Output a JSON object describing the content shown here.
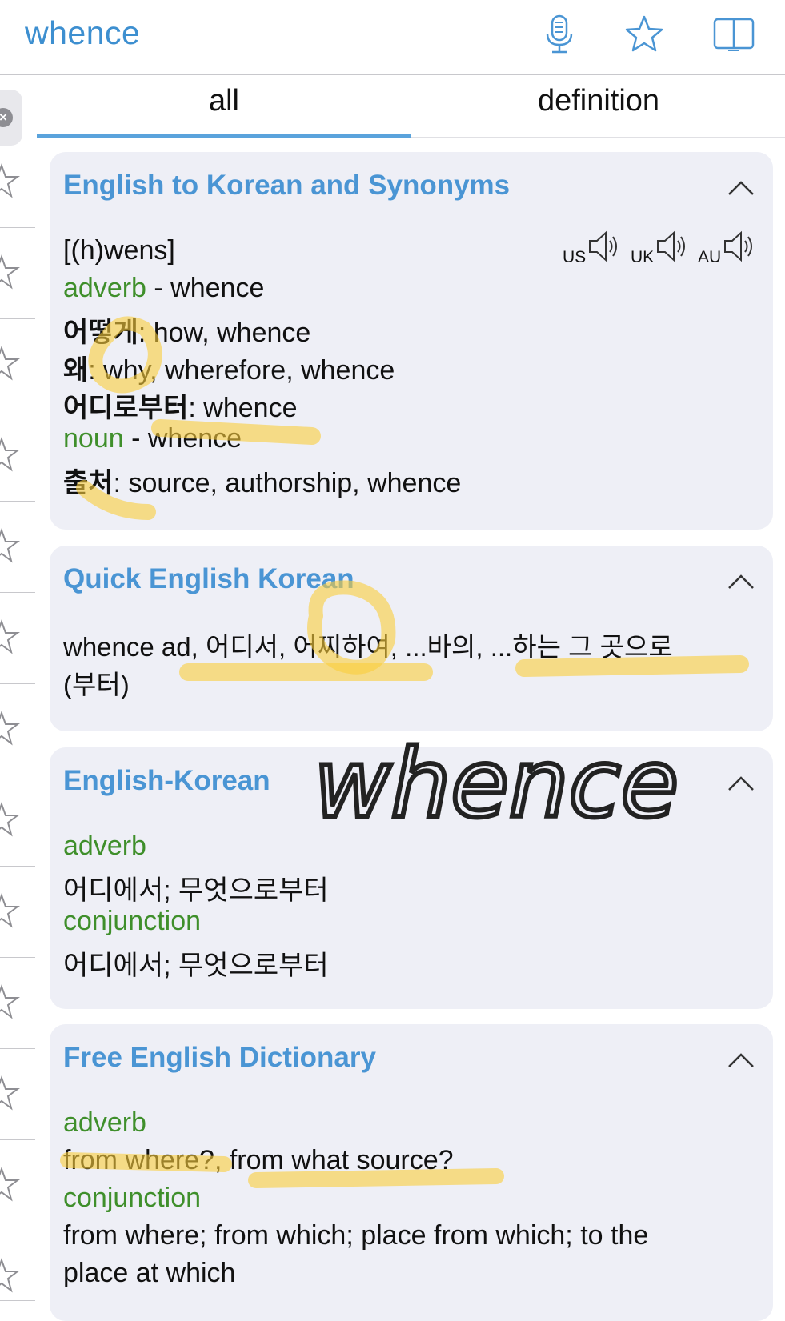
{
  "header": {
    "search_term": "whence",
    "icons": [
      "microphone-icon",
      "star-icon",
      "book-icon"
    ]
  },
  "tabs": [
    {
      "label": "all",
      "active": true
    },
    {
      "label": "definition",
      "active": false
    }
  ],
  "sections": {
    "eng_kor_syn": {
      "title": "English to Korean and Synonyms",
      "pronunciation": "[(h)wens]",
      "accents": [
        "US",
        "UK",
        "AU"
      ],
      "lines": [
        {
          "pos": "adverb",
          "text": " - whence"
        },
        {
          "ko": "어떻게",
          "text": ": how, whence"
        },
        {
          "ko": "왜",
          "text": ": why, wherefore, whence"
        },
        {
          "ko": "어디로부터",
          "text": ": whence"
        },
        {
          "pos": "noun",
          "text": " - whence"
        },
        {
          "ko": "출처",
          "text": ": source, authorship, whence"
        }
      ]
    },
    "quick_eng_kor": {
      "title": "Quick English Korean",
      "line1": "whence ad, 어디서, 어찌하여, ...바의, ...하는 그 곳으로",
      "line2": "(부터)"
    },
    "eng_kor": {
      "title": "English-Korean",
      "pos1": "adverb",
      "def1": "어디에서; 무엇으로부터",
      "pos2": "conjunction",
      "def2": "어디에서; 무엇으로부터"
    },
    "free_dict": {
      "title": "Free English Dictionary",
      "pos1": "adverb",
      "def1": "from where?, from what source?",
      "pos2": "conjunction",
      "def2_line1": "from where; from which; place from which; to the",
      "def2_line2": "place at which"
    }
  },
  "handwritten_note": "whence",
  "colors": {
    "accent": "#3d8fd0",
    "section_title": "#4a95d4",
    "part_of_speech": "#3f8f2b",
    "card_bg": "#eeeff6",
    "highlighter": "#facd3c"
  }
}
